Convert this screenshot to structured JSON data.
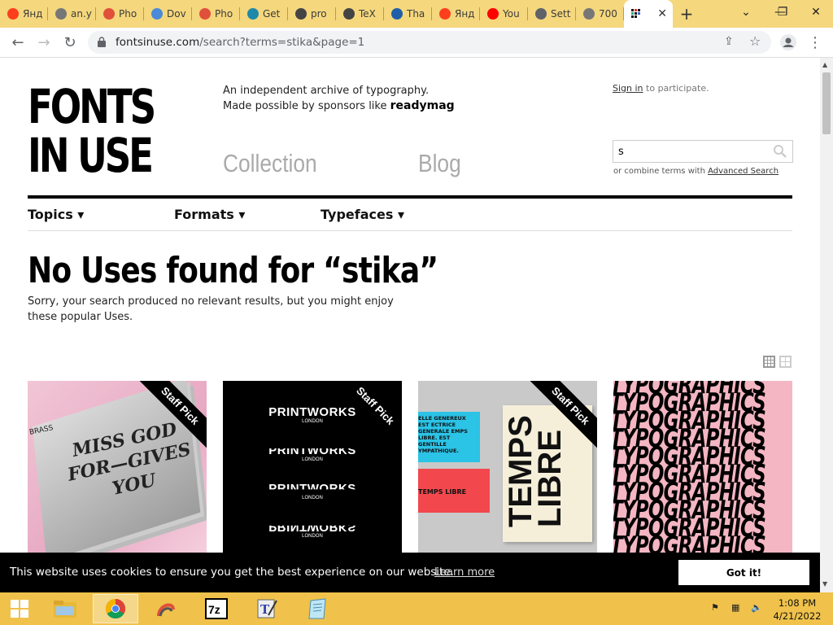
{
  "browser": {
    "tabs": [
      {
        "label": "Янд",
        "icon": "yandex-icon",
        "color": "#fc3f1d"
      },
      {
        "label": "an.y",
        "icon": "globe-icon",
        "color": "#777777"
      },
      {
        "label": "Pho",
        "icon": "photopea-icon",
        "color": "#e1503a"
      },
      {
        "label": "Dov",
        "icon": "globe-icon",
        "color": "#4a8ad8"
      },
      {
        "label": "Pho",
        "icon": "photopea-icon",
        "color": "#e1503a"
      },
      {
        "label": "Get",
        "icon": "bird-icon",
        "color": "#1e88a8"
      },
      {
        "label": "pro",
        "icon": "tex-icon",
        "color": "#444444"
      },
      {
        "label": "TeX",
        "icon": "tex-icon",
        "color": "#444444"
      },
      {
        "label": "Tha",
        "icon": "tex-circle-icon",
        "color": "#1f5fa8"
      },
      {
        "label": "Янд",
        "icon": "yandex-icon",
        "color": "#fc3f1d"
      },
      {
        "label": "You",
        "icon": "youtube-icon",
        "color": "#ff0000"
      },
      {
        "label": "Sett",
        "icon": "gear-icon",
        "color": "#5f6368"
      },
      {
        "label": "700",
        "icon": "globe-icon",
        "color": "#777777"
      }
    ],
    "active_tab_icon": "fontsinuse-icon",
    "url_host": "fontsinuse.com",
    "url_path": "/search?terms=stika&page=1"
  },
  "site": {
    "logo_line1": "FONTS",
    "logo_line2": "IN USE",
    "tagline1": "An independent archive of typography.",
    "tagline2": "Made possible by sponsors like",
    "sponsor": "readymag",
    "nav_collection": "Collection",
    "nav_blog": "Blog",
    "signin_link": "Sign in",
    "signin_rest": "to participate.",
    "search_value": "s",
    "combine_text": "or combine terms with",
    "combine_link": "Advanced Search",
    "categories": [
      "Topics ▾",
      "Formats ▾",
      "Typefaces ▾"
    ]
  },
  "results": {
    "heading": "No Uses found for “stika”",
    "message": "Sorry, your search produced no relevant results, but you might enjoy these popular Uses.",
    "cards": [
      {
        "ribbon": "Staff Pick",
        "art": [
          "MISS GOD",
          "FOR—GIVES",
          "YOU"
        ],
        "label": "BRASS"
      },
      {
        "ribbon": "Staff Pick",
        "art": [
          "PRINTWORKS",
          "PRINTWORKS",
          "PRINTWORKS",
          "PRINTWORKS"
        ],
        "sub": "LONDON"
      },
      {
        "ribbon": "Staff Pick",
        "art": [
          "TEMPS",
          "LIBRE"
        ],
        "blue_text": "ELLE GENEREUX EST ECTRICE GENERALE EMPS LIBRE. EST GENTILLE YMPATHIQUE.",
        "red_text": "TEMPS LIBRE"
      },
      {
        "art": [
          "TYPOGRAPHICS"
        ]
      }
    ]
  },
  "cookie": {
    "message": "This website uses cookies to ensure you get the best experience on our website.",
    "learn_more": "Learn more",
    "button": "Got it!"
  },
  "taskbar": {
    "time": "1:08 PM",
    "date": "4/21/2022"
  }
}
